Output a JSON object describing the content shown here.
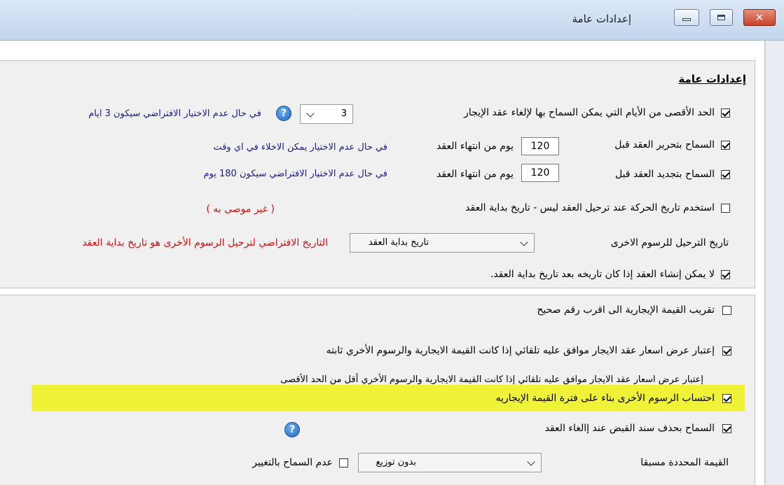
{
  "window": {
    "title": "إعدادات عامة",
    "close_glyph": "✕"
  },
  "section": {
    "title": "إعدادات عامة"
  },
  "options": {
    "max_days_cancel": {
      "label": "الحد الأقصى من الأيام التي يمكن السماح بها لإلغاء عقد الإيجار",
      "checked": true,
      "value": "3",
      "note": "في حال عدم الاختيار الافتراضي سيكون 3 ايام"
    },
    "allow_edit_contract": {
      "label": "السماح بتحرير العقد قبل",
      "checked": true,
      "value": "120",
      "unit": "يوم من انتهاء العقد",
      "note": "في حال عدم الاختيار يمكن الاخلاء في اي وقت"
    },
    "allow_renew_contract": {
      "label": "السماح بتجديد العقد قبل",
      "checked": true,
      "value": "120",
      "unit": "يوم من انتهاء العقد",
      "note": "في حال عدم الاختيار الافتراضي سيكون 180 يوم"
    },
    "use_movement_date": {
      "label": "استخدم تاريخ الحركة عند ترحيل العقد ليس - تاريخ بداية العقد",
      "checked": false,
      "note": "( غير موصى به )"
    },
    "other_fees_posting_date": {
      "label": "تاريخ الترحيل للرسوم الاخرى",
      "selected": "تاريخ بداية العقد",
      "note": "التاريخ الافتراضي لترحيل الرسوم الأخرى هو تاريخ بداية العقد"
    },
    "no_create_after_start": {
      "label": "لا يمكن إنشاء العقد إذا كان تاريخه بعد تاريخ بداية العقد.",
      "checked": true
    },
    "round_rent": {
      "label": "تقريب القيمة الإيجارية الى اقرب رقم صحيح",
      "checked": false
    },
    "auto_approve_fixed": {
      "label": "إعتبار عرض اسعار عقد الايجار موافق عليه تلقائي  إذا كانت القيمة الايجارية والرسوم الأخري ثابته",
      "checked": true
    },
    "auto_approve_below_max": {
      "label": "إعتبار عرض اسعار عقد الايجار موافق عليه تلقائي  إذا كانت القيمة الايجارية والرسوم الأخري أقل من الحد الأقصى"
    },
    "calc_fees_by_period": {
      "label": "احتساب الرسوم الأخرى بناء على فترة القيمة الإيجاريه",
      "checked": true
    },
    "allow_delete_receipt": {
      "label": "السماح بحذف سند القبض عند إالغاء العقد",
      "checked": true
    },
    "predefined_value": {
      "label": "القيمة المحددة مسبقا",
      "selected": "بدون توزيع",
      "no_change_label": "عدم السماح بالتغيير",
      "no_change_checked": false
    }
  },
  "colors": {
    "highlight": "#f0f238",
    "note_blue": "#1a1a8c",
    "note_red": "#d01010"
  }
}
